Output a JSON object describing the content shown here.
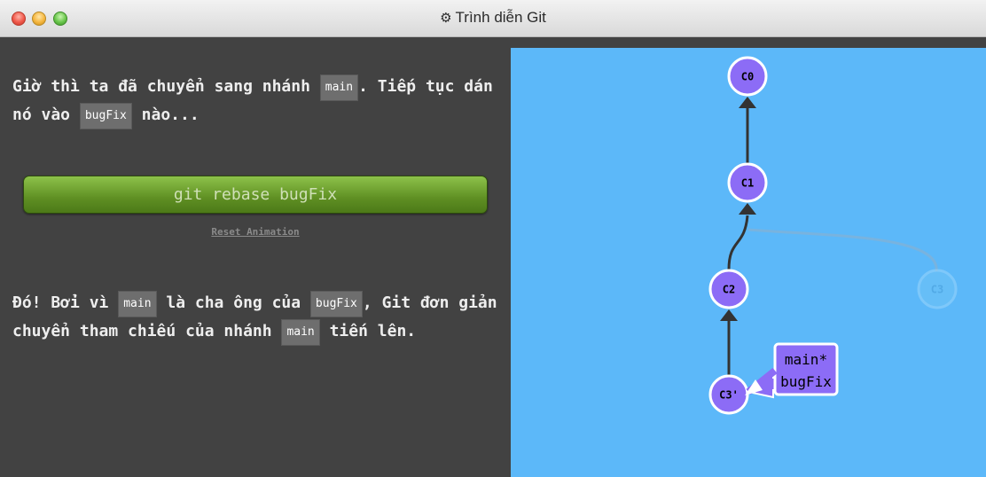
{
  "window": {
    "title": "Trình diễn Git",
    "title_icon": "gear-icon"
  },
  "instructions": {
    "p1": {
      "a": "Giờ thì ta đã chuyển sang nhánh ",
      "b": "main",
      "c": ". Tiếp tục dán nó vào ",
      "d": "bugFix",
      "e": " nào..."
    },
    "command_button": "git rebase bugFix",
    "reset_link": "Reset Animation",
    "p2": {
      "a": "Đó! Bởi vì ",
      "b": "main",
      "c": " là cha ông của ",
      "d": "bugFix",
      "e": ", Git đơn giản chuyển tham chiếu của nhánh ",
      "f": "main",
      "g": " tiến lên."
    }
  },
  "graph": {
    "commits": [
      {
        "id": "C0",
        "label": "C0",
        "parent": null,
        "faded": false
      },
      {
        "id": "C1",
        "label": "C1",
        "parent": "C0",
        "faded": false
      },
      {
        "id": "C2",
        "label": "C2",
        "parent": "C1",
        "faded": false
      },
      {
        "id": "C3",
        "label": "C3",
        "parent": "C1",
        "faded": true
      },
      {
        "id": "C3p",
        "label": "C3'",
        "parent": "C2",
        "faded": false
      }
    ],
    "branch_tag": {
      "target": "C3p",
      "line1": "main*",
      "line2": "bugFix"
    },
    "colors": {
      "background": "#5cb8f9",
      "commit": "#8c6cf6",
      "faded_commit": "#6fc3f7",
      "edge": "#333333"
    }
  }
}
